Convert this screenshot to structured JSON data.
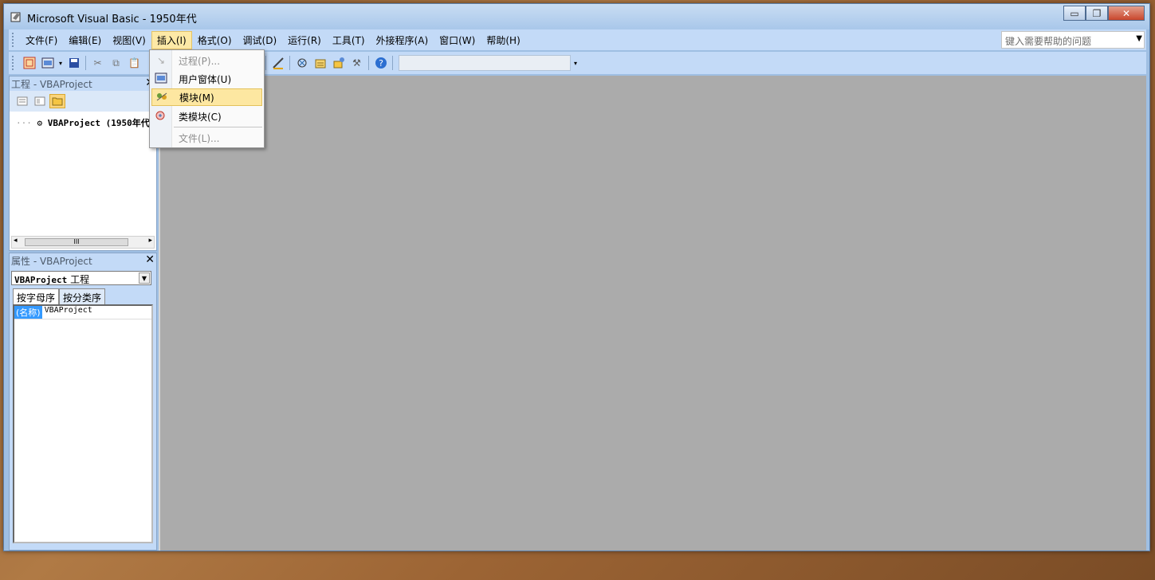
{
  "window": {
    "title": "Microsoft Visual Basic - 1950年代",
    "minimize": "▭",
    "restore": "❐",
    "close": "✕"
  },
  "menubar": {
    "items": [
      {
        "label": "文件(F)"
      },
      {
        "label": "编辑(E)"
      },
      {
        "label": "视图(V)"
      },
      {
        "label": "插入(I)"
      },
      {
        "label": "格式(O)"
      },
      {
        "label": "调试(D)"
      },
      {
        "label": "运行(R)"
      },
      {
        "label": "工具(T)"
      },
      {
        "label": "外接程序(A)"
      },
      {
        "label": "窗口(W)"
      },
      {
        "label": "帮助(H)"
      }
    ],
    "active_index": 3,
    "help_placeholder": "键入需要帮助的问题"
  },
  "insert_menu": {
    "items": [
      {
        "label": "过程(P)...",
        "icon": "procedure-icon",
        "state": "disabled"
      },
      {
        "label": "用户窗体(U)",
        "icon": "userform-icon",
        "state": "normal"
      },
      {
        "label": "模块(M)",
        "icon": "module-icon",
        "state": "hover"
      },
      {
        "label": "类模块(C)",
        "icon": "class-module-icon",
        "state": "normal"
      },
      {
        "label": "文件(L)...",
        "icon": "",
        "state": "disabled"
      }
    ]
  },
  "project_panel": {
    "title": "工程 - VBAProject",
    "tree_root": "VBAProject (1950年代"
  },
  "properties_panel": {
    "title": "属性 - VBAProject",
    "object_selected": "VBAProject",
    "object_type": "工程",
    "tabs": [
      "按字母序",
      "按分类序"
    ],
    "rows": [
      {
        "name": "(名称)",
        "value": "VBAProject"
      }
    ]
  },
  "scrollbar": {
    "thumb_grip": "III",
    "left": "◂",
    "right": "▸"
  },
  "colors": {
    "chrome": "#c3daf7",
    "workspace": "#ababab",
    "highlight": "#fde7a1"
  }
}
